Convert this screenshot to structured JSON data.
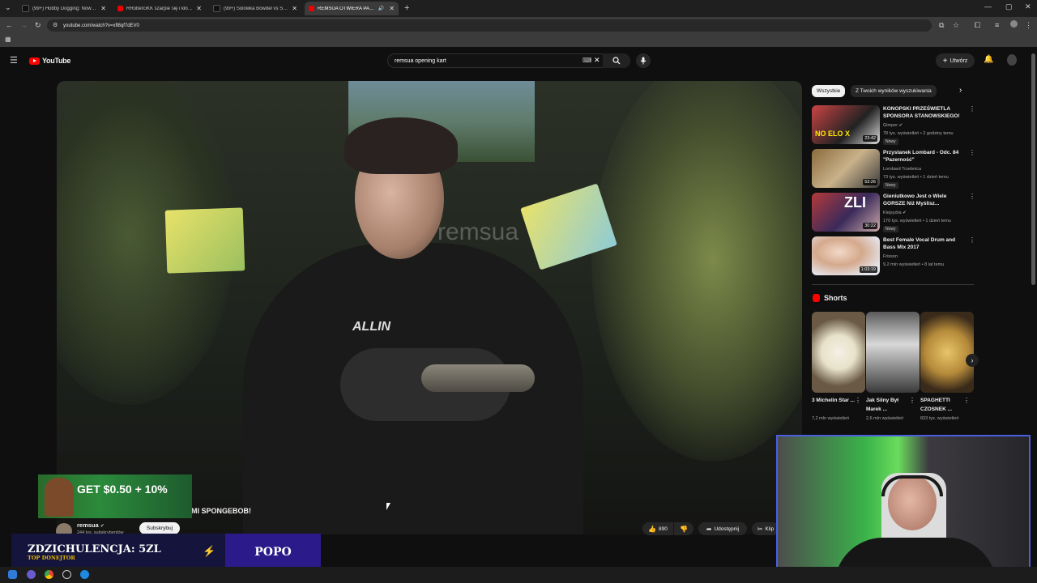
{
  "browser": {
    "tabs": [
      {
        "label": "(99+) Hobby Dogging: Nowy Tr...",
        "icon": "tiktok-icon",
        "active": false
      },
      {
        "label": "RRoberciKK szarpie się i kłóci z...",
        "icon": "youtube-icon",
        "active": false
      },
      {
        "label": "(99+) Solówka Bowdel vs Szachi...",
        "icon": "tiktok-icon",
        "active": false
      },
      {
        "label": "REMSUA OTWIERA PACZKI",
        "icon": "youtube-icon",
        "active": true
      }
    ],
    "new_tab": "+",
    "url": "youtube.com/watch?v=xfl8qf7dEV0"
  },
  "youtube": {
    "logo_text": "YouTube",
    "search_value": "remsua opening kart",
    "create_label": "Utwórz"
  },
  "video": {
    "watermark": "remsua",
    "title_partial": "MI SPONGEBOB!",
    "channel": "remsua",
    "subscribers": "244 tys. subskrybentów",
    "subscribe_label": "Subskrybuj",
    "likes": "890",
    "share_label": "Udostępnij",
    "clip_label": "Klip"
  },
  "filters": {
    "chips": [
      "Wszystkie",
      "Z Twoich wyników wyszukiwania"
    ]
  },
  "recommendations": [
    {
      "title": "KONOPSKI PRZEŚWIETLA SPONSORA STANOWSKIEGO!",
      "channel": "Gimper",
      "verified": true,
      "meta": "78 tys. wyświetleń • 2 godziny temu",
      "badge": "Nowy",
      "duration": "23:42"
    },
    {
      "title": "Przystanek Lombard - Odc. 84 \"Pazerność\"",
      "channel": "Lombard Trzebnica",
      "verified": false,
      "meta": "73 tys. wyświetleń • 1 dzień temu",
      "badge": "Nowy",
      "duration": "53:26"
    },
    {
      "title": "Gieniutkowo Jest o Wiele GORSZE Niż Myślisz...",
      "channel": "Klejsydra",
      "verified": true,
      "meta": "170 tys. wyświetleń • 1 dzień temu",
      "badge": "Nowy",
      "duration": "30:22"
    },
    {
      "title": "Best Female Vocal Drum and Bass Mix 2017",
      "channel": "Frisson",
      "verified": false,
      "meta": "9,2 mln wyświetleń • 8 lat temu",
      "badge": "",
      "duration": "1:03:19"
    }
  ],
  "shorts": {
    "heading": "Shorts",
    "items": [
      {
        "title": "3 Michelin Star ...",
        "views": "7,2 mln wyświetleń"
      },
      {
        "title": "Jak Silny Był Marek ...",
        "views": "2,6 mln wyświetleń"
      },
      {
        "title": "SPAGHETTI CZOSNEK ...",
        "views": "833 tys. wyświetleń"
      }
    ]
  },
  "overlay": {
    "ad_text": "GET $0.50 + 10%",
    "donor_text": "ZDZICHULENCJA: 5ZL",
    "donor_sub": "TOP DONEJTOR",
    "popo_text": "POPO"
  }
}
